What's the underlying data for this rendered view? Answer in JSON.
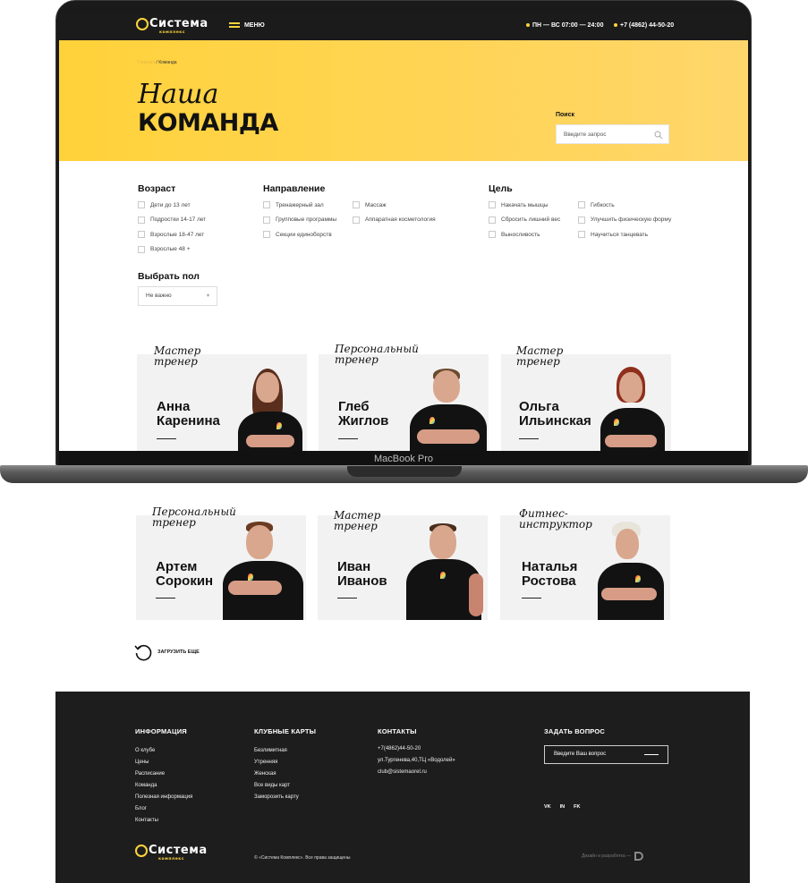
{
  "device": {
    "chin_label": "MacBook Pro"
  },
  "header": {
    "logo_main": "Система",
    "logo_sub": "комплекс",
    "menu_label": "МЕНЮ",
    "hours": "ПН — ВС 07:00 — 24:00",
    "phone": "+7 (4862) 44-50-20"
  },
  "hero": {
    "breadcrumb_home": "Главная",
    "breadcrumb_sep": "/",
    "breadcrumb_current": "Команда",
    "title_script": "Наша",
    "title_bold": "КОМАНДА",
    "search_label": "Поиск",
    "search_placeholder": "Введите запрос"
  },
  "filters": {
    "age": {
      "title": "Возраст",
      "options": [
        "Дети до 13 лет",
        "Подростки 14-17 лет",
        "Взрослые 18-47 лет",
        "Взрослые 48 +"
      ]
    },
    "direction": {
      "title": "Направление",
      "col1": [
        "Тренажерный зал",
        "Групповые программы",
        "Секции единоборств"
      ],
      "col2": [
        "Массаж",
        "Аппаратная косметология"
      ]
    },
    "goal": {
      "title": "Цель",
      "col1": [
        "Накачать мышцы",
        "Сбросить лишний вес",
        "Выносливость"
      ],
      "col2": [
        "Гибкость",
        "Улучшить физическую форму",
        "Научиться танцевать"
      ]
    },
    "gender": {
      "title": "Выбрать пол",
      "selected": "Не важно"
    }
  },
  "trainers": [
    {
      "role": "Мастер тренер",
      "first": "Анна",
      "last": "Каренина"
    },
    {
      "role": "Персональный тренер",
      "first": "Глеб",
      "last": "Жиглов"
    },
    {
      "role": "Мастер тренер",
      "first": "Ольга",
      "last": "Ильинская"
    },
    {
      "role": "Персональный тренер",
      "first": "Артем",
      "last": "Сорокин"
    },
    {
      "role": "Мастер тренер",
      "first": "Иван",
      "last": "Иванов"
    },
    {
      "role": "Фитнес-инструктор",
      "first": "Наталья",
      "last": "Ростова"
    }
  ],
  "load_more": "ЗАГРУЗИТЬ ЕЩЕ",
  "footer": {
    "info": {
      "title": "ИНФОРМАЦИЯ",
      "links": [
        "О клубе",
        "Цены",
        "Расписание",
        "Команда",
        "Полезная информация",
        "Блог",
        "Контакты"
      ]
    },
    "cards": {
      "title": "КЛУБНЫЕ КАРТЫ",
      "links": [
        "Безлимитная",
        "Утренняя",
        "Женская",
        "Все виды карт",
        "Заморозить карту"
      ]
    },
    "contacts": {
      "title": "КОНТАКТЫ",
      "lines": [
        "+7(4862)44-50-20",
        "ул.Тургенева,40,ТЦ «Водолей»",
        "club@sistemaorel.ru"
      ]
    },
    "ask": {
      "title": "ЗАДАТЬ ВОПРОС",
      "placeholder": "Введите Ваш вопрос"
    },
    "social": [
      "VK",
      "IN",
      "FK"
    ],
    "copyright": "© «Система Комплекс». Все права защищены",
    "credit": "Дизайн и разработка —"
  }
}
